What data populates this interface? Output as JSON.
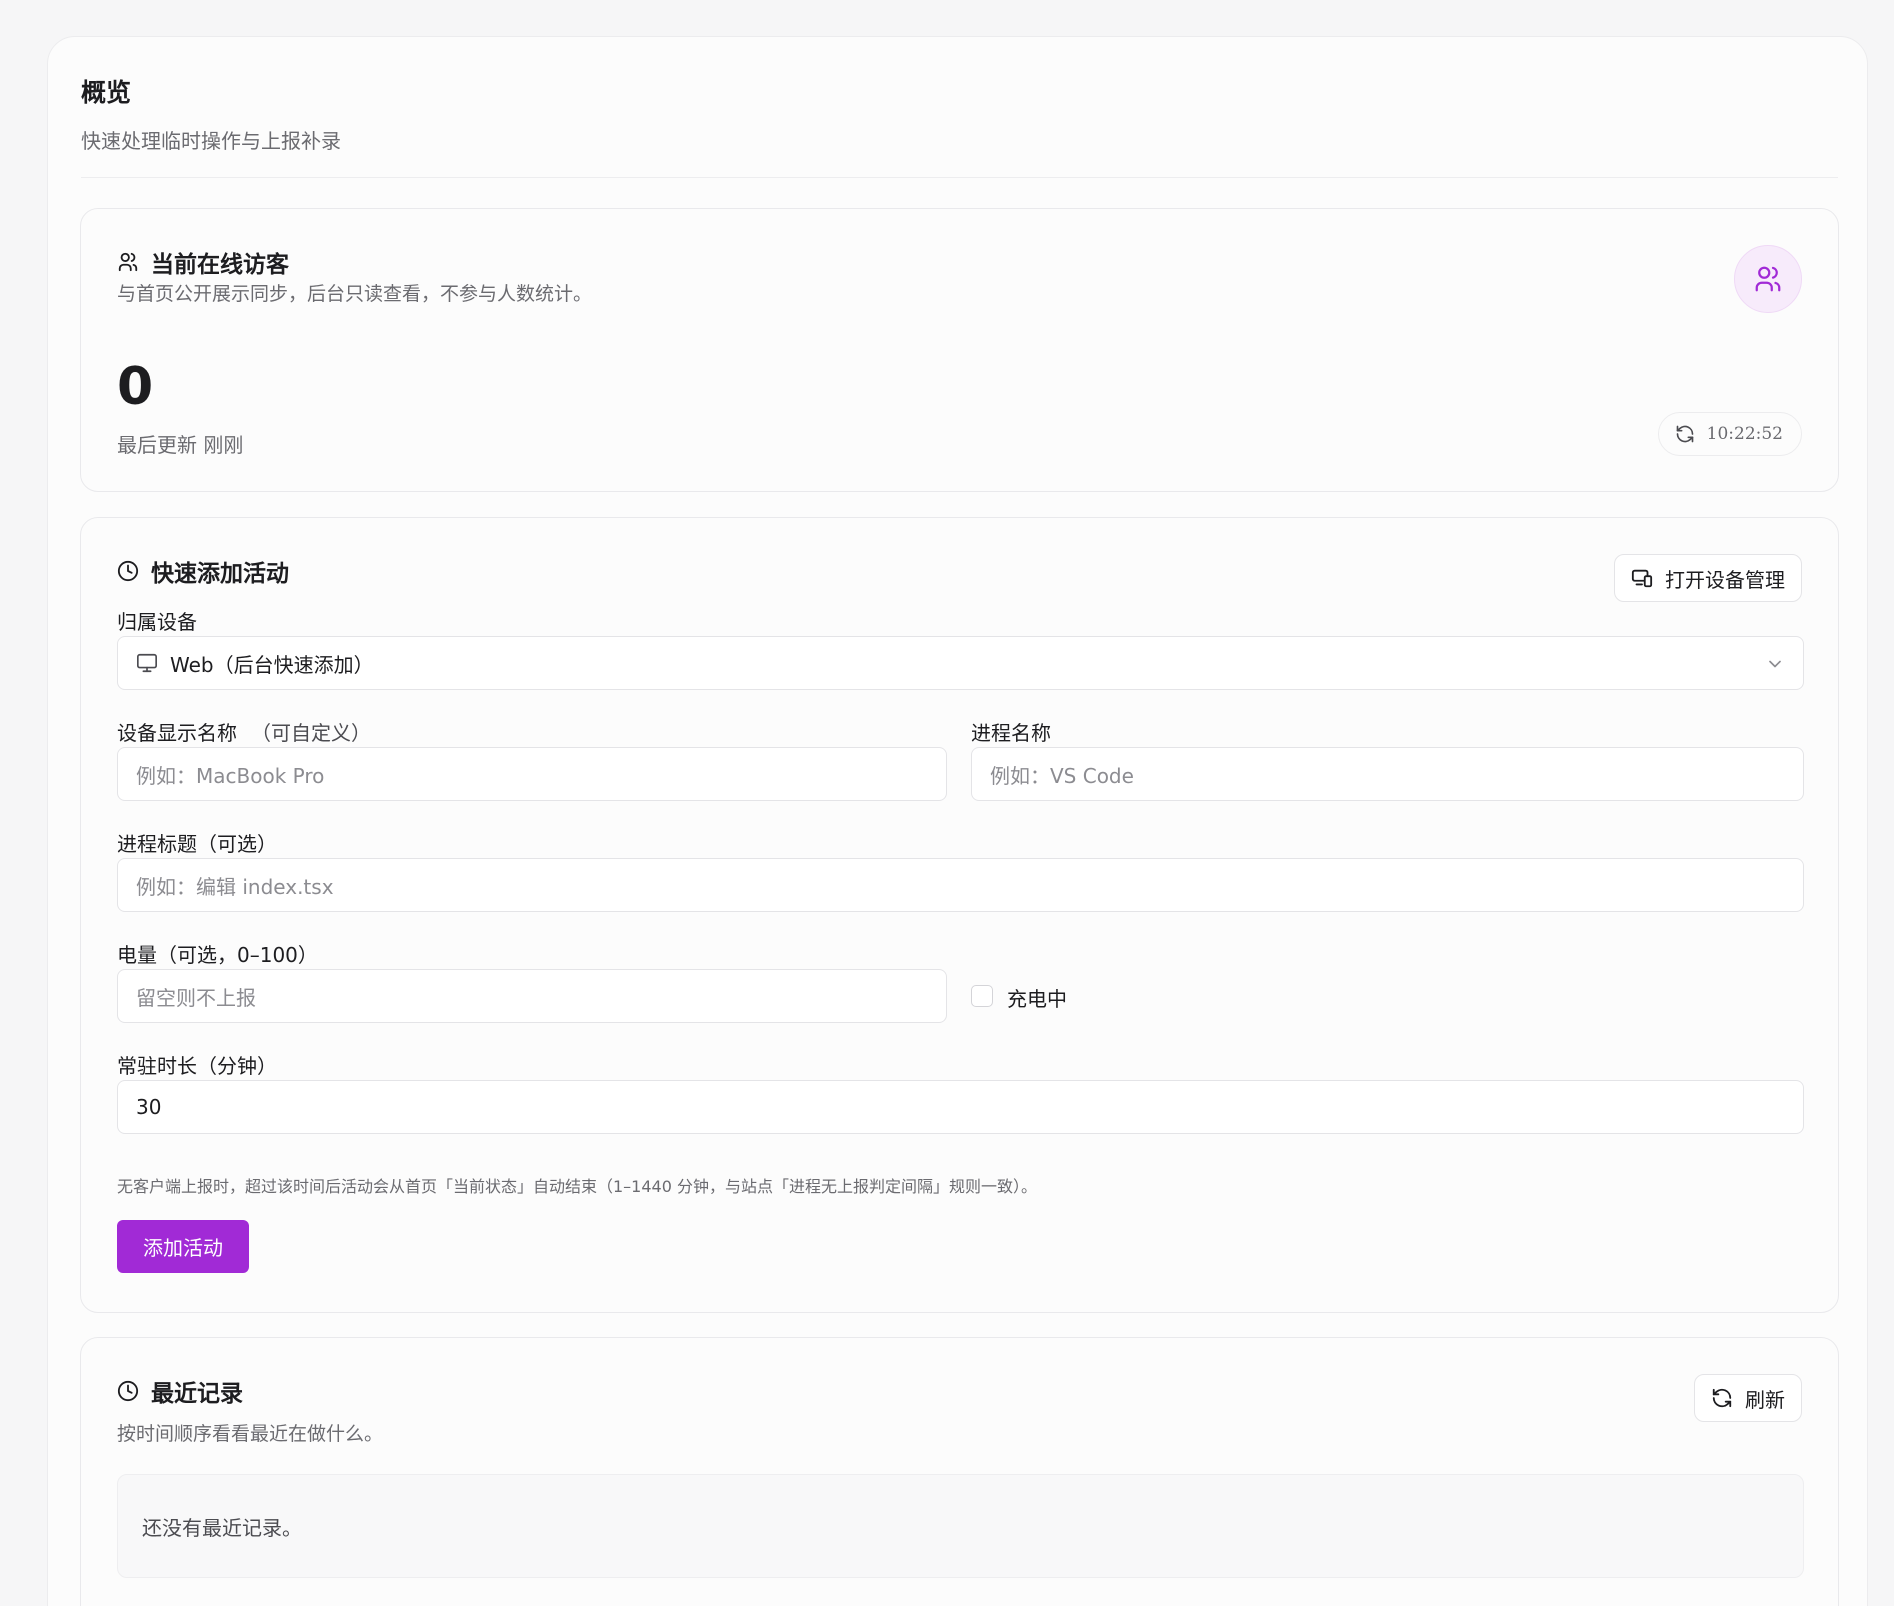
{
  "header": {
    "title": "概览",
    "subtitle": "快速处理临时操作与上报补录"
  },
  "visitors": {
    "title": "当前在线访客",
    "description": "与首页公开展示同步，后台只读查看，不参与人数统计。",
    "count": "0",
    "last_updated": "最后更新 刚刚",
    "time": "10:22:52",
    "icon": "users-icon",
    "accent_color": "#a12ad6"
  },
  "quick_add": {
    "title": "快速添加活动",
    "open_device_button": "打开设备管理",
    "device_label": "归属设备",
    "device_value": "Web（后台快速添加）",
    "display_name_label": "设备显示名称",
    "display_name_hint": "（可自定义）",
    "display_name_placeholder": "例如：MacBook Pro",
    "process_name_label": "进程名称",
    "process_name_placeholder": "例如：VS Code",
    "process_title_label": "进程标题（可选）",
    "process_title_placeholder": "例如：编辑 index.tsx",
    "battery_label": "电量（可选，0–100）",
    "battery_placeholder": "留空则不上报",
    "charging_label": "充电中",
    "duration_label": "常驻时长（分钟）",
    "duration_value": "30",
    "helper_text": "无客户端上报时，超过该时间后活动会从首页「当前状态」自动结束（1–1440 分钟，与站点「进程无上报判定间隔」规则一致）。",
    "submit_button": "添加活动"
  },
  "recent": {
    "title": "最近记录",
    "description": "按时间顺序看看最近在做什么。",
    "refresh_button": "刷新",
    "empty_text": "还没有最近记录。"
  }
}
